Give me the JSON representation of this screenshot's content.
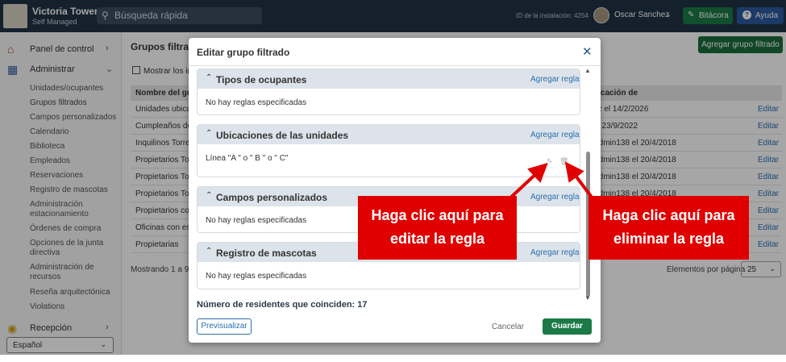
{
  "topbar": {
    "building_name": "Victoria Towers",
    "building_sub": "Self Managed",
    "search_placeholder": "Búsqueda rápida",
    "install_id": "ID de la instalación: 4254",
    "user_name": "Oscar Sanchez",
    "bitacora": "Bitácora",
    "help": "Ayuda"
  },
  "sidebar": {
    "panel": "Panel de control",
    "admin": "Administrar",
    "reception": "Recepción",
    "items": [
      "Unidades/ocupantes",
      "Grupos filtrados",
      "Campos personalizados",
      "Calendario",
      "Biblioteca",
      "Empleados",
      "Reservaciones",
      "Registro de mascotas",
      "Administración estacionamiento",
      "Órdenes de compra",
      "Opciones de la junta directiva",
      "Administración de recursos",
      "Reseña arquitectónica",
      "Violations"
    ],
    "language": "Español"
  },
  "main": {
    "title": "Grupos filtrad",
    "add_group": "Agregar grupo filtrado",
    "show_checkbox": "Mostrar los ina",
    "col_name": "Nombre del grup",
    "col_modified": "ificación de",
    "rows": [
      {
        "name": "Unidades ubicad",
        "modified": "ez el 14/2/2026",
        "action": "Editar"
      },
      {
        "name": "Cumpleaños de S",
        "modified": "el 23/9/2022",
        "action": "Editar"
      },
      {
        "name": "Inquilinos Torre 1",
        "modified": "Admin138 el 20/4/2018",
        "action": "Editar"
      },
      {
        "name": "Propietarios Torr",
        "modified": "Admin138 el 20/4/2018",
        "action": "Editar"
      },
      {
        "name": "Propietarios Torr",
        "modified": "Admin138 el 20/4/2018",
        "action": "Editar"
      },
      {
        "name": "Propietarios Torr",
        "modified": "Admin138 el 20/4/2018",
        "action": "Editar"
      },
      {
        "name": "Propietarios con",
        "modified": "",
        "action": "Editar"
      },
      {
        "name": "Oficinas con esta",
        "modified": "",
        "action": "Editar"
      },
      {
        "name": "Propietarias",
        "modified": "",
        "action": "Editar"
      }
    ],
    "showing": "Mostrando 1 a 9 d",
    "per_page_label": "Elementos por página",
    "per_page_value": "25"
  },
  "modal": {
    "title": "Editar grupo filtrado",
    "sections": [
      {
        "title": "Tipos de ocupantes",
        "add": "Agregar regla",
        "body": "No hay reglas especificadas"
      },
      {
        "title": "Ubicaciones de las unidades",
        "add": "Agregar regla",
        "body": "Línea \"A \" o \" B \" o \" C\""
      },
      {
        "title": "Campos personalizados",
        "add": "Agregar regla",
        "body": "No hay reglas especificadas"
      },
      {
        "title": "Registro de mascotas",
        "add": "Agregar regla",
        "body": "No hay reglas especificadas"
      }
    ],
    "matches": "Número de residentes que coinciden: 17",
    "preview": "Previsualizar",
    "cancel": "Cancelar",
    "save": "Guardar"
  },
  "callouts": {
    "edit_line1": "Haga clic aquí para",
    "edit_line2": "editar la regla",
    "delete_line1": "Haga clic aquí para",
    "delete_line2": "eliminar la regla"
  },
  "colors": {
    "topbar": "#1f3346",
    "primary_green": "#1b7a45",
    "help_blue": "#2c5aa0",
    "link": "#2a6fb0",
    "callout": "#e00000"
  }
}
